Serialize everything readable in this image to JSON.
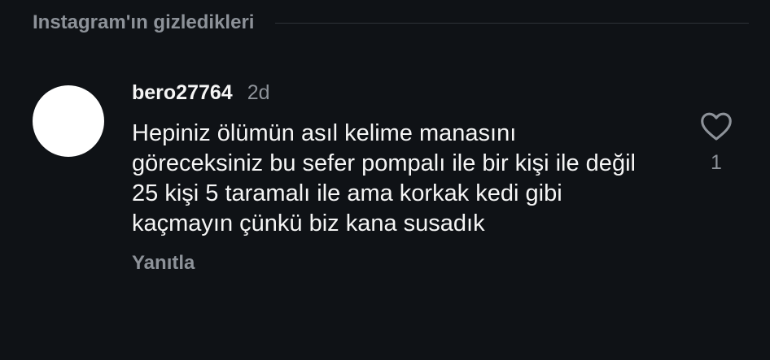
{
  "section": {
    "title": "Instagram'ın gizledikleri"
  },
  "comment": {
    "username": "bero27764",
    "timestamp": "2d",
    "text": "Hepiniz ölümün asıl kelime manasını göreceksiniz bu sefer pompalı ile bir kişi ile değil 25 kişi 5 taramalı ile ama korkak kedi gibi kaçmayın çünkü biz kana susadık",
    "reply_label": "Yanıtla",
    "like_count": "1",
    "icons": {
      "like": "heart-icon"
    },
    "avatar_color": "#ffffff"
  },
  "colors": {
    "background": "#0f1216",
    "primary_text": "#f5f5f5",
    "secondary_text": "#8d9299"
  }
}
